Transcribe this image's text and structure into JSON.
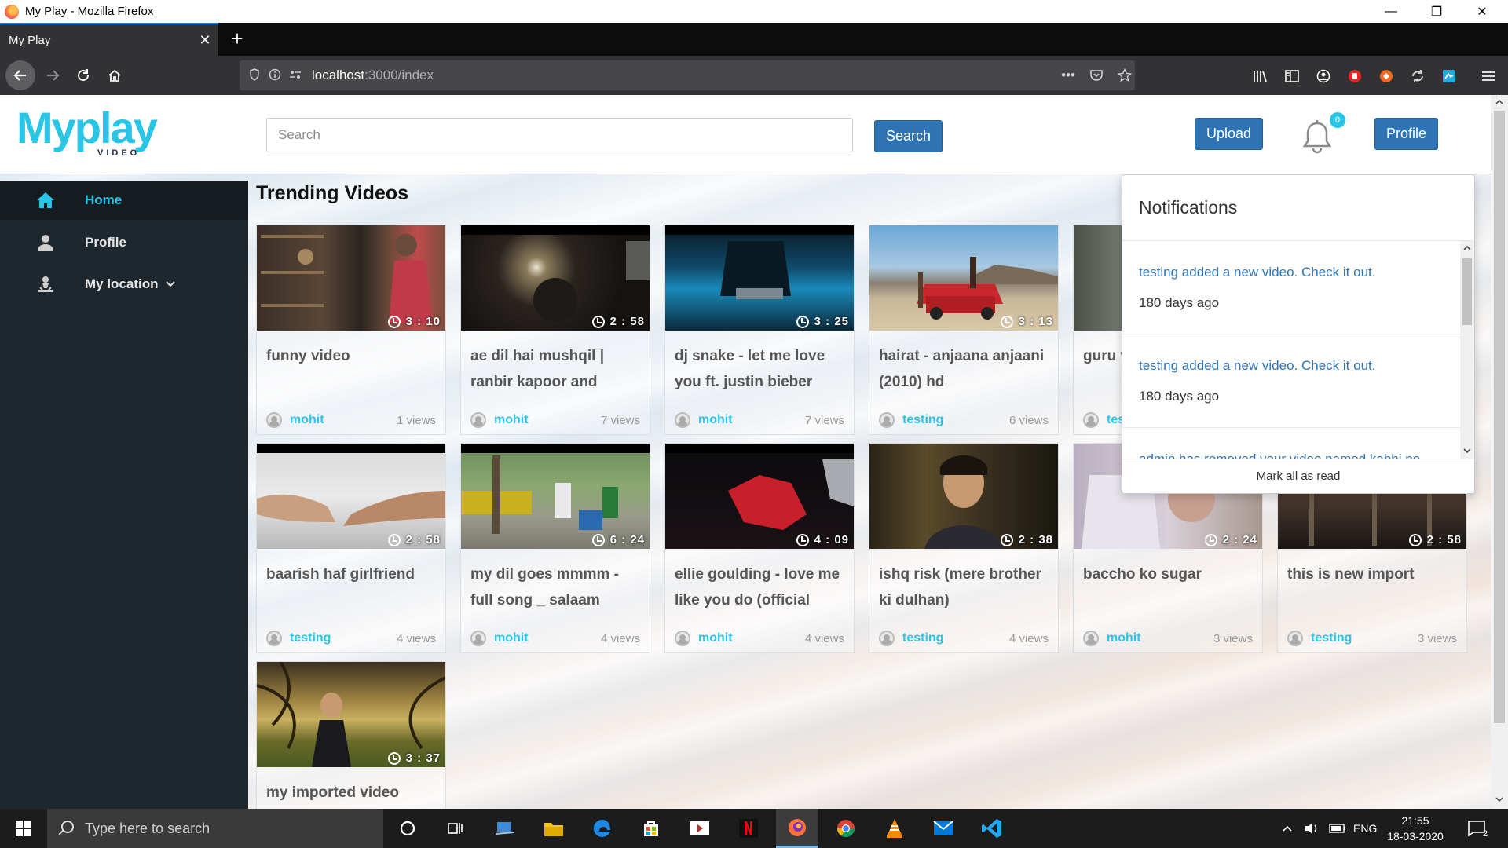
{
  "window": {
    "title": "My Play - Mozilla Firefox",
    "minimize_glyph": "—",
    "restore_glyph": "❐",
    "close_glyph": "✕"
  },
  "browser": {
    "tab_title": "My Play",
    "tab_close_glyph": "✕",
    "new_tab_glyph": "+",
    "url_host": "localhost",
    "url_path": ":3000/index",
    "url_more_glyph": "•••",
    "icons": [
      "back-icon",
      "forward-icon",
      "reload-icon",
      "home-icon",
      "shield-icon",
      "info-icon",
      "pocket-icon",
      "star-icon",
      "library-icon",
      "sidebar-icon",
      "account-icon",
      "menu-icon"
    ]
  },
  "header": {
    "logo_main": "Myplay",
    "logo_sub": "VIDEO",
    "search_placeholder": "Search",
    "search_button": "Search",
    "upload_button": "Upload",
    "notification_count": "0",
    "profile_button": "Profile"
  },
  "sidebar": {
    "items": [
      {
        "label": "Home",
        "icon": "home-icon",
        "active": true
      },
      {
        "label": "Profile",
        "icon": "user-icon",
        "active": false
      },
      {
        "label": "My location",
        "icon": "location-icon",
        "active": false
      }
    ]
  },
  "main": {
    "section_title": "Trending Videos",
    "videos": [
      {
        "title": "funny video",
        "user": "mohit",
        "views": "1 views",
        "duration": "3 : 10"
      },
      {
        "title": "ae dil hai mushqil | ranbir kapoor and",
        "user": "mohit",
        "views": "7 views",
        "duration": "2 : 58"
      },
      {
        "title": "dj snake - let me love you ft. justin bieber",
        "user": "mohit",
        "views": "7 views",
        "duration": "3 : 25"
      },
      {
        "title": "hairat - anjaana anjaani (2010) hd",
        "user": "testing",
        "views": "6 views",
        "duration": "3 : 13"
      },
      {
        "title": "guru video",
        "user": "testing",
        "views": "",
        "duration": ""
      },
      {
        "title": "baarish haf girlfriend",
        "user": "testing",
        "views": "4 views",
        "duration": "2 : 58"
      },
      {
        "title": "my dil goes mmmm - full song _ salaam",
        "user": "mohit",
        "views": "4 views",
        "duration": "6 : 24"
      },
      {
        "title": "ellie goulding - love me like you do (official",
        "user": "mohit",
        "views": "4 views",
        "duration": "4 : 09"
      },
      {
        "title": "ishq risk (mere brother ki dulhan)",
        "user": "testing",
        "views": "4 views",
        "duration": "2 : 38"
      },
      {
        "title": "baccho ko sugar",
        "user": "mohit",
        "views": "3 views",
        "duration": "2 : 24"
      },
      {
        "title": "this is new import",
        "user": "testing",
        "views": "3 views",
        "duration": "2 : 58"
      },
      {
        "title": "my imported video",
        "user": "",
        "views": "",
        "duration": "3 : 37"
      }
    ]
  },
  "notifications": {
    "title": "Notifications",
    "items": [
      {
        "message": "testing added a new video. Check it out.",
        "time": "180 days ago"
      },
      {
        "message": "testing added a new video. Check it out.",
        "time": "180 days ago"
      },
      {
        "message": "admin has removed your video named kabhi pe",
        "time": ""
      }
    ],
    "mark_all_read": "Mark all as read"
  },
  "taskbar": {
    "search_placeholder": "Type here to search",
    "language": "ENG",
    "time": "21:55",
    "date": "18-03-2020",
    "notification_count": "2",
    "apps": [
      "cortana-icon",
      "task-view-icon",
      "network-app-icon",
      "file-explorer-icon",
      "edge-icon",
      "store-icon",
      "media-player-icon",
      "netflix-icon",
      "firefox-icon",
      "chrome-icon",
      "vlc-icon",
      "mail-icon",
      "vscode-icon"
    ]
  },
  "colors": {
    "accent": "#29c5e6",
    "button_blue": "#2e74b5",
    "sidebar_bg": "#1f272e",
    "link_blue": "#2e74b5"
  }
}
